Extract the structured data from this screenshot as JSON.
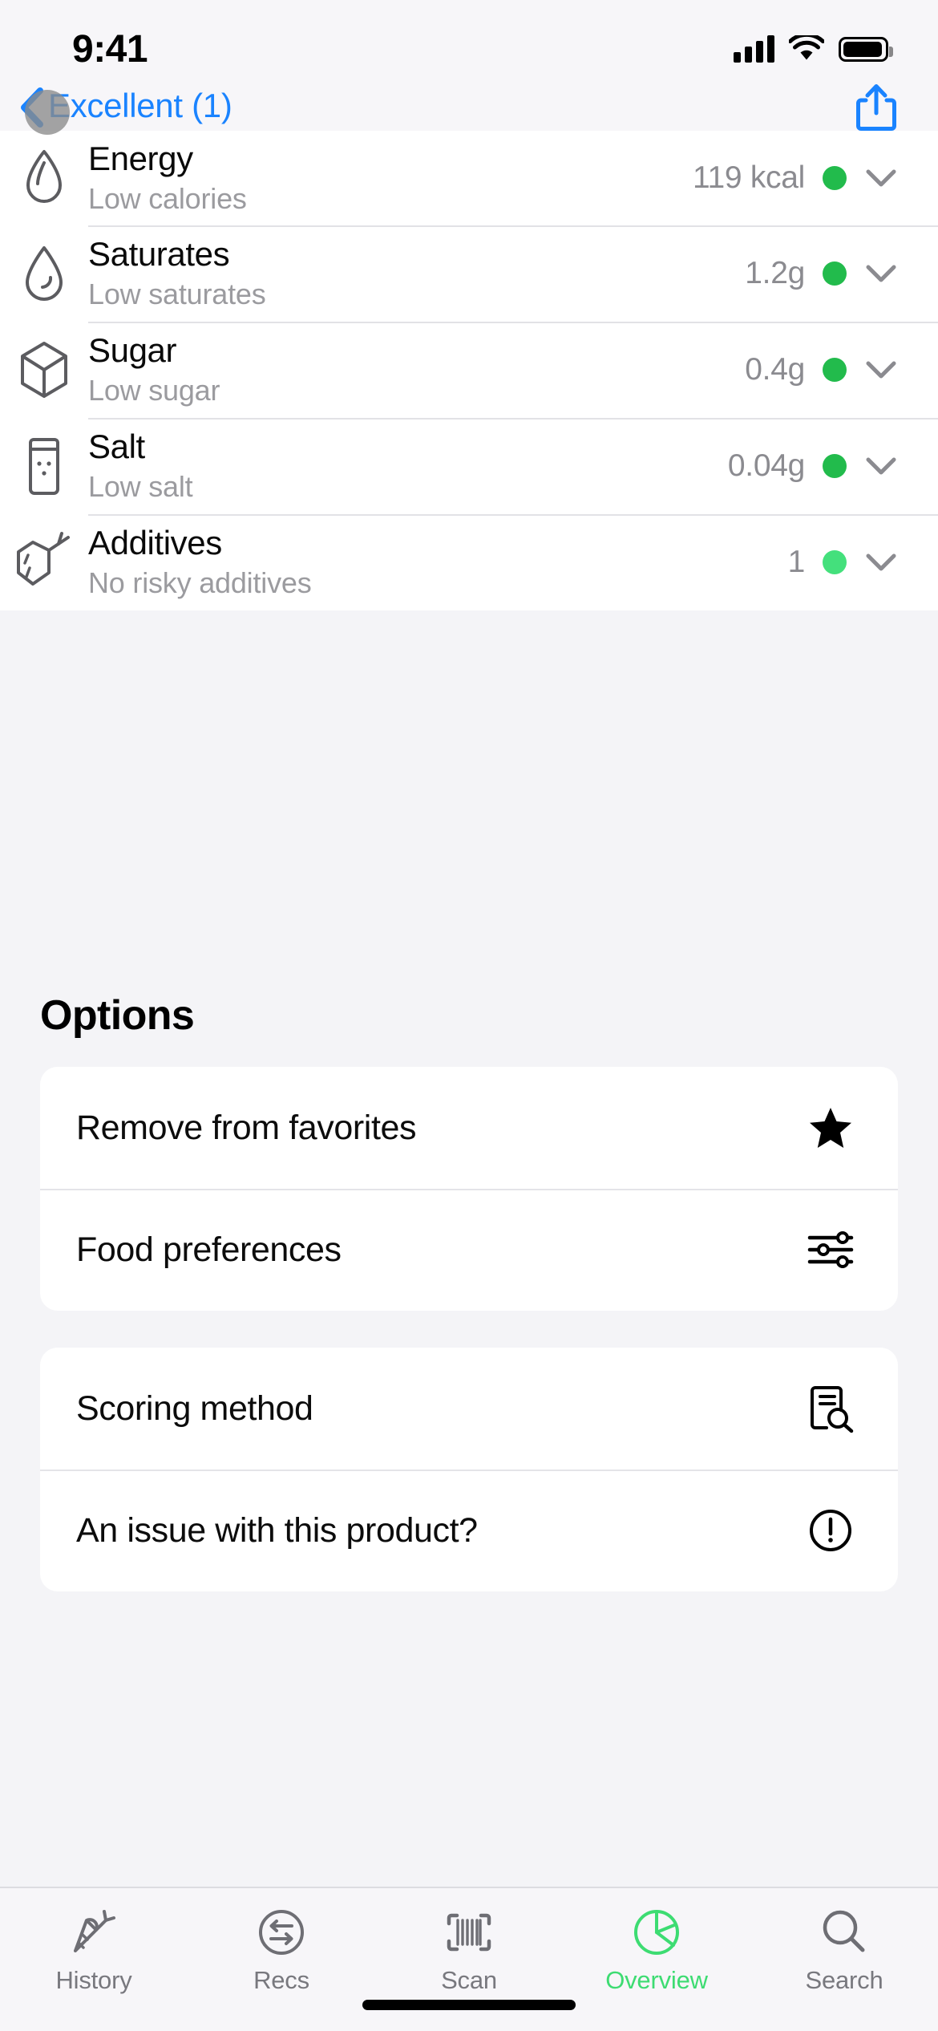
{
  "status_bar": {
    "time": "9:41",
    "cellular_icon": "cellular-signal-icon",
    "wifi_icon": "wifi-icon",
    "battery_icon": "battery-icon"
  },
  "nav": {
    "back_label": "Excellent (1)",
    "back_icon": "chevron-left-icon",
    "share_icon": "share-icon",
    "accent_color": "#1a83ff"
  },
  "nutrition": {
    "rows": [
      {
        "icon": "flame-icon",
        "title": "Energy",
        "subtitle": "Low calories",
        "value": "119 kcal",
        "dot_color": "#22bb4c",
        "expand_icon": "chevron-down-icon"
      },
      {
        "icon": "droplet-icon",
        "title": "Saturates",
        "subtitle": "Low saturates",
        "value": "1.2g",
        "dot_color": "#22bb4c",
        "expand_icon": "chevron-down-icon"
      },
      {
        "icon": "sugar-cube-icon",
        "title": "Sugar",
        "subtitle": "Low sugar",
        "value": "0.4g",
        "dot_color": "#22bb4c",
        "expand_icon": "chevron-down-icon"
      },
      {
        "icon": "salt-shaker-icon",
        "title": "Salt",
        "subtitle": "Low salt",
        "value": "0.04g",
        "dot_color": "#22bb4c",
        "expand_icon": "chevron-down-icon"
      },
      {
        "icon": "molecule-icon",
        "title": "Additives",
        "subtitle": "No risky additives",
        "value": "1",
        "dot_color": "#44e07c",
        "expand_icon": "chevron-down-icon"
      }
    ]
  },
  "options": {
    "heading": "Options",
    "card_one": [
      {
        "label": "Remove from favorites",
        "icon": "star-filled-icon"
      },
      {
        "label": "Food preferences",
        "icon": "sliders-icon"
      }
    ],
    "card_two": [
      {
        "label": "Scoring method",
        "icon": "document-search-icon"
      },
      {
        "label": "An issue with this product?",
        "icon": "exclamation-circle-icon"
      }
    ]
  },
  "tabbar": {
    "active_color": "#3ddc72",
    "inactive_color": "#78787e",
    "tabs": [
      {
        "label": "History",
        "icon": "carrot-icon",
        "active": false
      },
      {
        "label": "Recs",
        "icon": "swap-circle-icon",
        "active": false
      },
      {
        "label": "Scan",
        "icon": "barcode-icon",
        "active": false
      },
      {
        "label": "Overview",
        "icon": "pie-chart-icon",
        "active": true
      },
      {
        "label": "Search",
        "icon": "search-icon",
        "active": false
      }
    ]
  }
}
